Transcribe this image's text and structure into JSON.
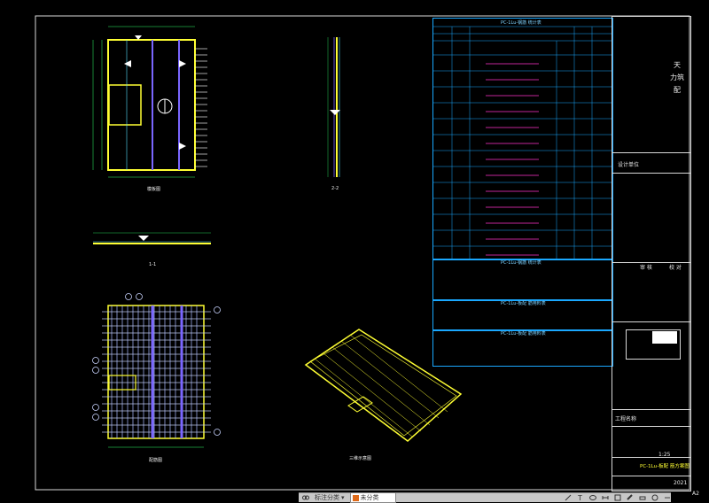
{
  "drawing": {
    "views": {
      "plan_label": "模板图",
      "section_22_label": "2-2",
      "section_11_label": "1-1",
      "rebar_plan_label": "配筋图",
      "iso_label": "三维示意图"
    },
    "title_block": {
      "side_note_1": "天",
      "side_note_2": "力筑",
      "side_note_3": "配",
      "design_unit_label": "设计单位",
      "sign_col_1": "审 核",
      "sign_col_2": "校 对",
      "sheet_title": "PC-1Lu-板配 筋方案图",
      "scale_label": "1:25",
      "date_label": "2021",
      "project_label": "工程名称",
      "page_no": "A2"
    },
    "tables": {
      "t1_title": "PC-1Lu-钢筋 统计表",
      "t2_title": "PC-1Lu-钢筋 统计表",
      "t3_title": "PC-1Lu-板配 筋用料表",
      "t4_title": "PC-1Lu-板配 筋用料表"
    }
  },
  "toolbar": {
    "btn_1": "标注分类",
    "btn_2": "未分类"
  },
  "colors": {
    "background": "#000000",
    "frame": "#d9d9d9",
    "yellow": "#ffff33",
    "cyan": "#55e0ff",
    "blue": "#1aa8ff",
    "magenta": "#ff33cc",
    "violet": "#7a66ff"
  }
}
